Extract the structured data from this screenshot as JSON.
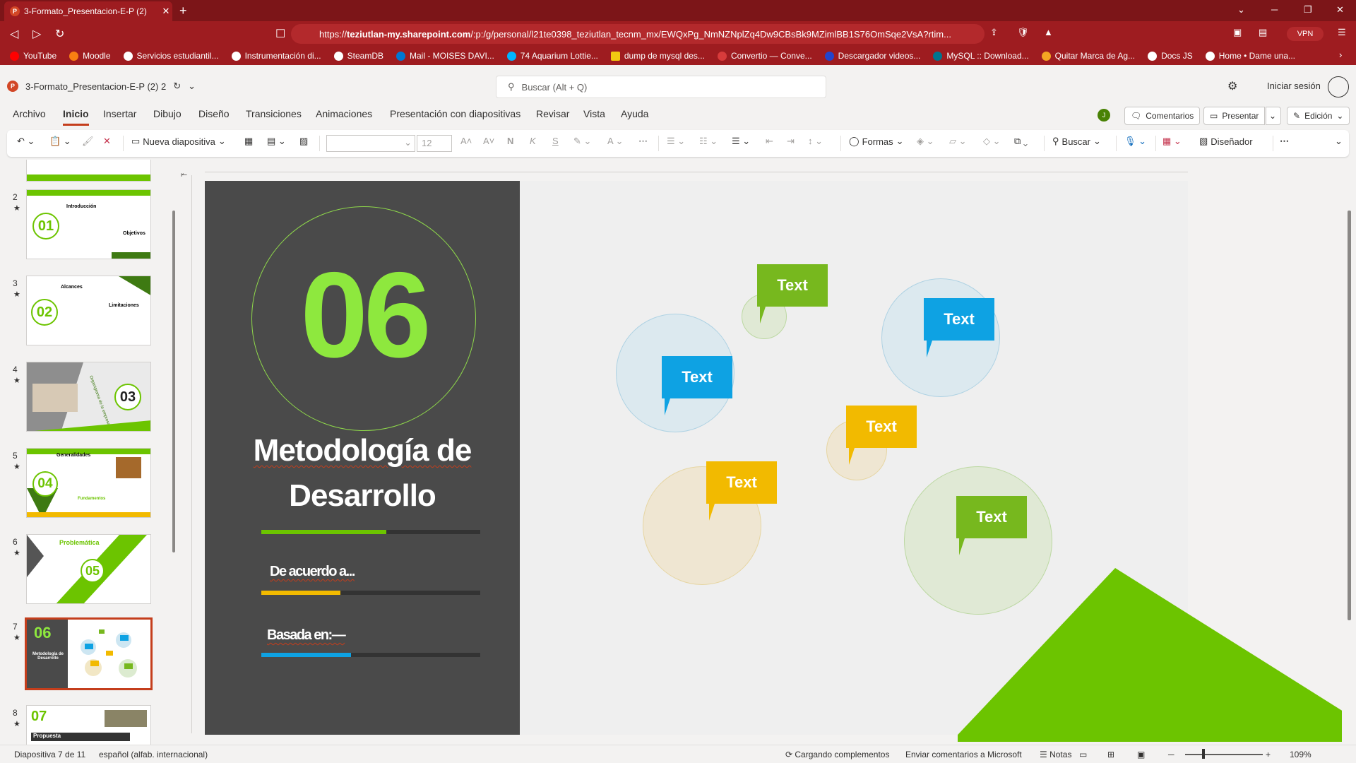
{
  "browser": {
    "tab_title": "3-Formato_Presentacion-E-P (2)",
    "url_prefix": "https://",
    "url_host": "teziutlan-my.sharepoint.com",
    "url_rest": "/:p:/g/personal/l21te0398_teziutlan_tecnm_mx/EWQxPg_NmNZNplZq4Dw9CBsBk9MZimlBB1S76OmSqe2VsA?rtim...",
    "vpn_label": "VPN",
    "bookmarks": [
      "YouTube",
      "Moodle",
      "Servicios estudiantil...",
      "Instrumentación di...",
      "SteamDB",
      "Mail - MOISES DAVI...",
      "74 Aquarium Lottie...",
      "dump de mysql des...",
      "Convertio — Conve...",
      "Descargador videos...",
      "MySQL :: Download...",
      "Quitar Marca de Ag...",
      "Docs JS",
      "Home • Dame una..."
    ]
  },
  "app": {
    "file_name": "3-Formato_Presentacion-E-P (2) 2",
    "search_placeholder": "Buscar (Alt + Q)",
    "signin": "Iniciar sesión",
    "user_initial": "J",
    "menu": [
      "Archivo",
      "Inicio",
      "Insertar",
      "Dibujo",
      "Diseño",
      "Transiciones",
      "Animaciones",
      "Presentación con diapositivas",
      "Revisar",
      "Vista",
      "Ayuda"
    ],
    "comments": "Comentarios",
    "present": "Presentar",
    "edit": "Edición"
  },
  "ribbon": {
    "new_slide": "Nueva diapositiva",
    "font_size": "12",
    "shapes": "Formas",
    "find": "Buscar",
    "designer": "Diseñador"
  },
  "thumbnails": [
    {
      "num": "2",
      "big": "01",
      "text1": "Introducción",
      "text2": "Objetivos"
    },
    {
      "num": "3",
      "big": "02",
      "text1": "Alcances",
      "text2": "Limitaciones"
    },
    {
      "num": "4",
      "big": "03",
      "text1": "Organigrama de la empresa",
      "text2": ""
    },
    {
      "num": "5",
      "big": "04",
      "text1": "Generalidades",
      "text2": "Fundamentos"
    },
    {
      "num": "6",
      "big": "05",
      "text1": "Problemática",
      "text2": ""
    },
    {
      "num": "7",
      "big": "06",
      "text1": "Metodología de Desarrollo",
      "text2": ""
    },
    {
      "num": "8",
      "big": "07",
      "text1": "Propuesta",
      "text2": ""
    }
  ],
  "slide": {
    "number": "06",
    "title_line1": "Metodología de",
    "title_line2": "Desarrollo",
    "sub1": "De acuerdo a...",
    "sub2": "Basada en:—",
    "tag_label": "Text",
    "colors": {
      "green": "#77b81e",
      "blue": "#0ea2e3",
      "yellow": "#f2ba00",
      "lime": "#8ee83e",
      "dark": "#4a4a4a"
    },
    "progress": [
      0.57,
      0.36,
      0.41
    ]
  },
  "status": {
    "slide_info": "Diapositiva 7 de 11",
    "language": "español (alfab. internacional)",
    "loading": "Cargando complementos",
    "feedback": "Enviar comentarios a Microsoft",
    "notes": "Notas",
    "zoom": "109%"
  }
}
